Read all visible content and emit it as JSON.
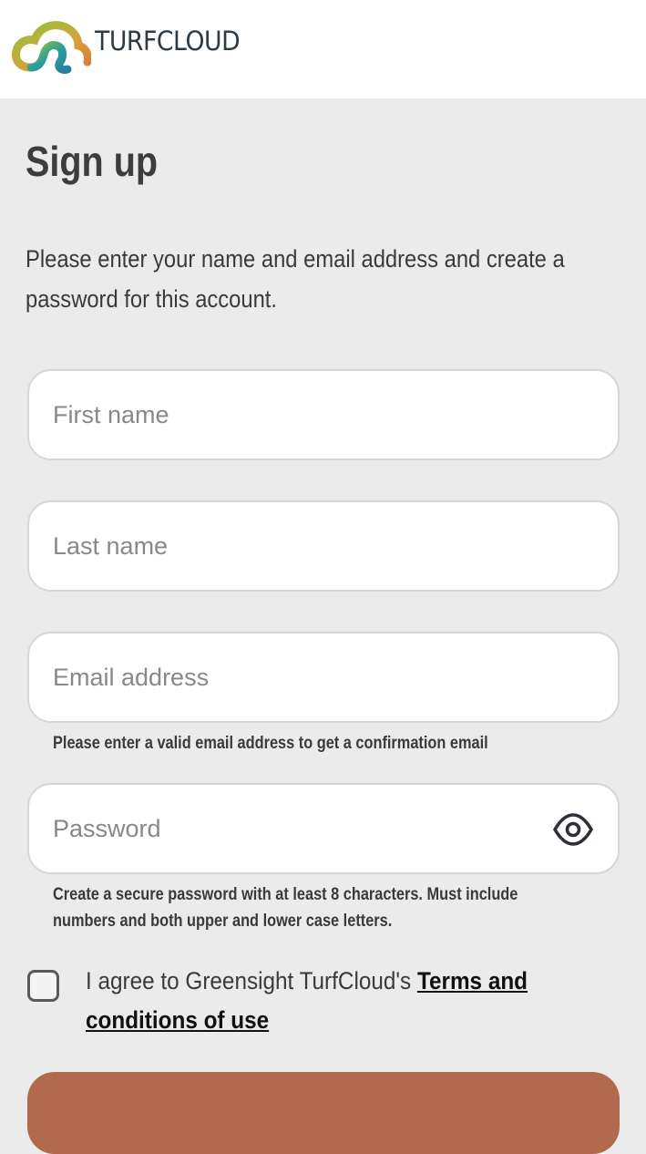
{
  "header": {
    "brand": "TURFCLOUD",
    "logo_icon": "turfcloud-logo-icon",
    "colors": {
      "green": "#7bbf42",
      "teal": "#2a9d9a",
      "orange": "#d98a3a",
      "text": "#2e3a44"
    }
  },
  "page": {
    "title": "Sign up",
    "intro_line1": "Please enter your name and email address and create a",
    "intro_line2": "password for this account."
  },
  "form": {
    "first_name": {
      "placeholder": "First name",
      "value": ""
    },
    "last_name": {
      "placeholder": "Last name",
      "value": ""
    },
    "email": {
      "placeholder": "Email address",
      "value": "",
      "hint": "Please enter a valid email address to get a confirmation email"
    },
    "password": {
      "placeholder": "Password",
      "value": "",
      "toggle_icon": "eye-icon",
      "hint_line1": "Create a secure password with at least 8 characters. Must include",
      "hint_line2": "numbers and both upper and lower case letters."
    },
    "terms": {
      "checked": false,
      "text": "I agree to Greensight TurfCloud's ",
      "link_line1": "Terms and",
      "link_line2": "conditions of use"
    },
    "submit_color": "#b2694e"
  }
}
